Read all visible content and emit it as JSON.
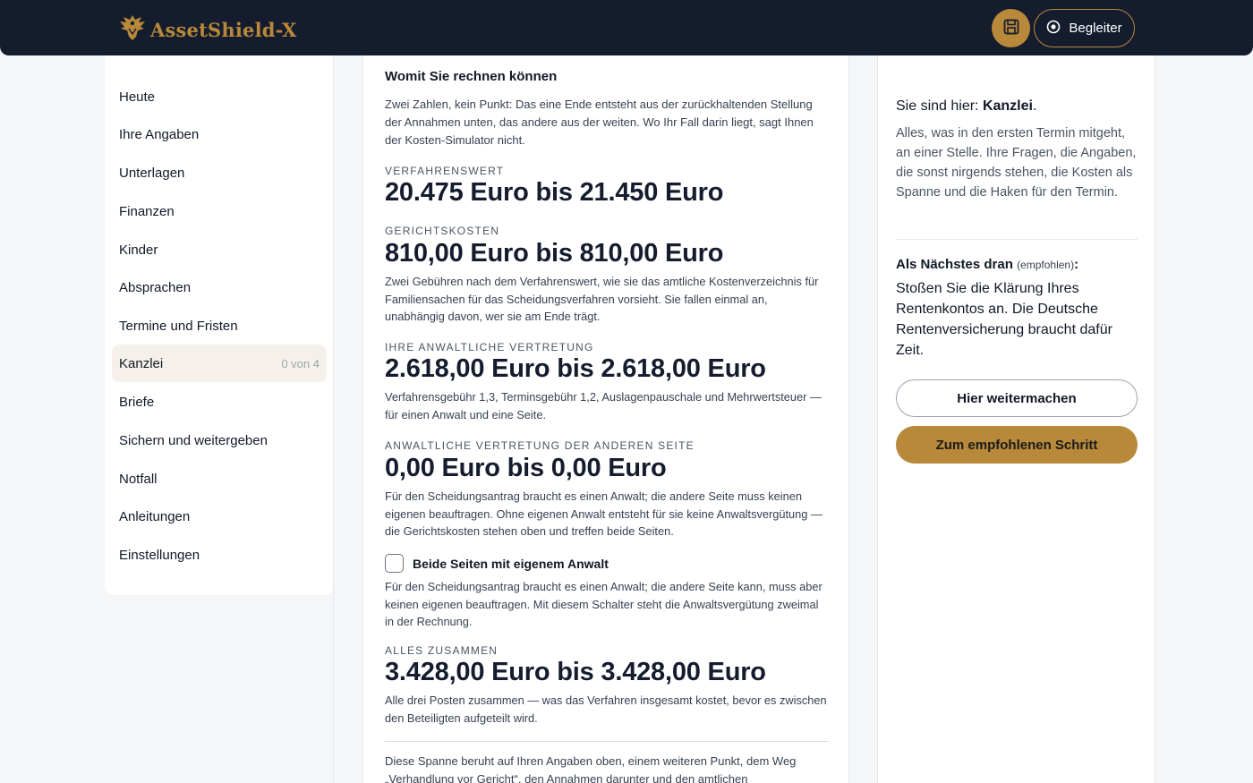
{
  "app": {
    "brand_name": "AssetShield-X",
    "logo_icon": "eagle-logo",
    "accent_color": "#b8893a",
    "header_color": "#141c2e"
  },
  "header": {
    "save_icon": "floppy-disk-icon",
    "companion_label": "Begleiter",
    "companion_icon": "target-circle-icon"
  },
  "sidebar": {
    "items": [
      {
        "label": "Heute"
      },
      {
        "label": "Ihre Angaben"
      },
      {
        "label": "Unterlagen"
      },
      {
        "label": "Finanzen"
      },
      {
        "label": "Kinder"
      },
      {
        "label": "Absprachen"
      },
      {
        "label": "Termine und Fristen"
      },
      {
        "label": "Kanzlei",
        "count": "0 von 4",
        "active": true
      },
      {
        "label": "Briefe"
      },
      {
        "label": "Sichern und weitergeben"
      },
      {
        "label": "Notfall"
      },
      {
        "label": "Anleitungen"
      },
      {
        "label": "Einstellungen"
      }
    ]
  },
  "main": {
    "section_title": "Womit Sie rechnen können",
    "intro": "Zwei Zahlen, kein Punkt: Das eine Ende entsteht aus der zurückhaltenden Stellung der Annahmen unten, das andere aus der weiten. Wo Ihr Fall darin liegt, sagt Ihnen der Kosten-Simulator nicht.",
    "verfahrenswert": {
      "caption": "Verfahrenswert",
      "value": "20.475 Euro bis 21.450 Euro"
    },
    "gerichtskosten": {
      "caption": "Gerichtskosten",
      "value": "810,00 Euro bis 810,00 Euro",
      "note": "Zwei Gebühren nach dem Verfahrenswert, wie sie das amtliche Kostenverzeichnis für Familiensachen für das Scheidungsverfahren vorsieht. Sie fallen einmal an, unabhängig davon, wer sie am Ende trägt."
    },
    "anwalt": {
      "caption": "Ihre anwaltliche Vertretung",
      "value": "2.618,00 Euro bis 2.618,00 Euro",
      "note": "Verfahrensgebühr 1,3, Terminsgebühr 1,2, Auslagenpauschale und Mehrwertsteuer — für einen Anwalt und eine Seite."
    },
    "gegenseite": {
      "caption": "Anwaltliche Vertretung der anderen Seite",
      "value": "0,00 Euro bis 0,00 Euro",
      "note": "Für den Scheidungsantrag braucht es einen Anwalt; die andere Seite muss keinen eigenen beauftragen. Ohne eigenen Anwalt entsteht für sie keine Anwaltsvergütung — die Gerichtskosten stehen oben und treffen beide Seiten."
    },
    "checkbox": {
      "label": "Beide Seiten mit eigenem Anwalt",
      "checked": false,
      "note": "Für den Scheidungsantrag braucht es einen Anwalt; die andere Seite kann, muss aber keinen eigenen beauftragen. Mit diesem Schalter steht die Anwaltsvergütung zweimal in der Rechnung."
    },
    "total": {
      "caption": "Alles zusammen",
      "value": "3.428,00 Euro bis 3.428,00 Euro",
      "note": "Alle drei Posten zusammen — was das Verfahren insgesamt kostet, bevor es zwischen den Beteiligten aufgeteilt wird."
    },
    "footer_text": "Diese Spanne beruht auf Ihren Angaben oben, einem weiteren Punkt, dem Weg „Verhandlung vor Gericht“, den Annahmen darunter und den amtlichen"
  },
  "panel": {
    "here_prefix": "Sie sind hier: ",
    "here_location": "Kanzlei",
    "here_suffix": ".",
    "description": "Alles, was in den ersten Termin mitgeht, an einer Stelle. Ihre Fragen, die Angaben, die sonst nirgends stehen, die Kosten als Spanne und die Haken für den Termin.",
    "next_title": "Als Nächstes dran",
    "next_hint": "(empfohlen)",
    "next_colon": ":",
    "next_text": "Stoßen Sie die Klärung Ihres Rentenkontos an. Die Deutsche Rentenversicherung braucht dafür Zeit.",
    "continue_label": "Hier weitermachen",
    "recommended_label": "Zum empfohlenen Schritt"
  }
}
